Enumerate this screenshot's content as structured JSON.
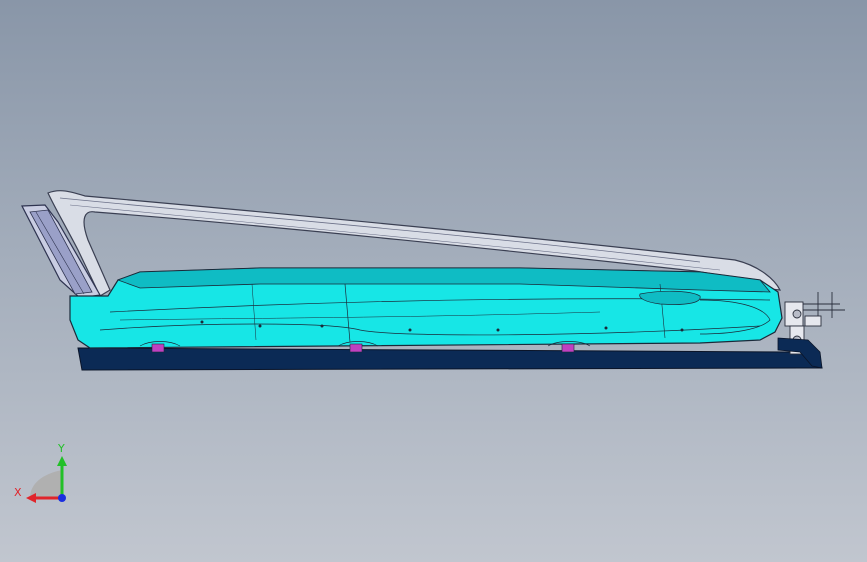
{
  "viewport": {
    "background_top": "#8996a8",
    "background_bottom": "#c1c6cf"
  },
  "model": {
    "body_color": "#17e6e6",
    "body_shade": "#0fbcc4",
    "edge_color": "#1a2a3a",
    "frame_color": "#d9dde6",
    "frame_edge": "#3a3f52",
    "base_color": "#0b2a55",
    "fastener_color": "#c040c0"
  },
  "triad": {
    "x_label": "X",
    "y_label": "Y",
    "x_color": "#e0242a",
    "y_color": "#22c028",
    "z_color": "#1a2ee0",
    "plane_color": "#b0b0b0"
  }
}
